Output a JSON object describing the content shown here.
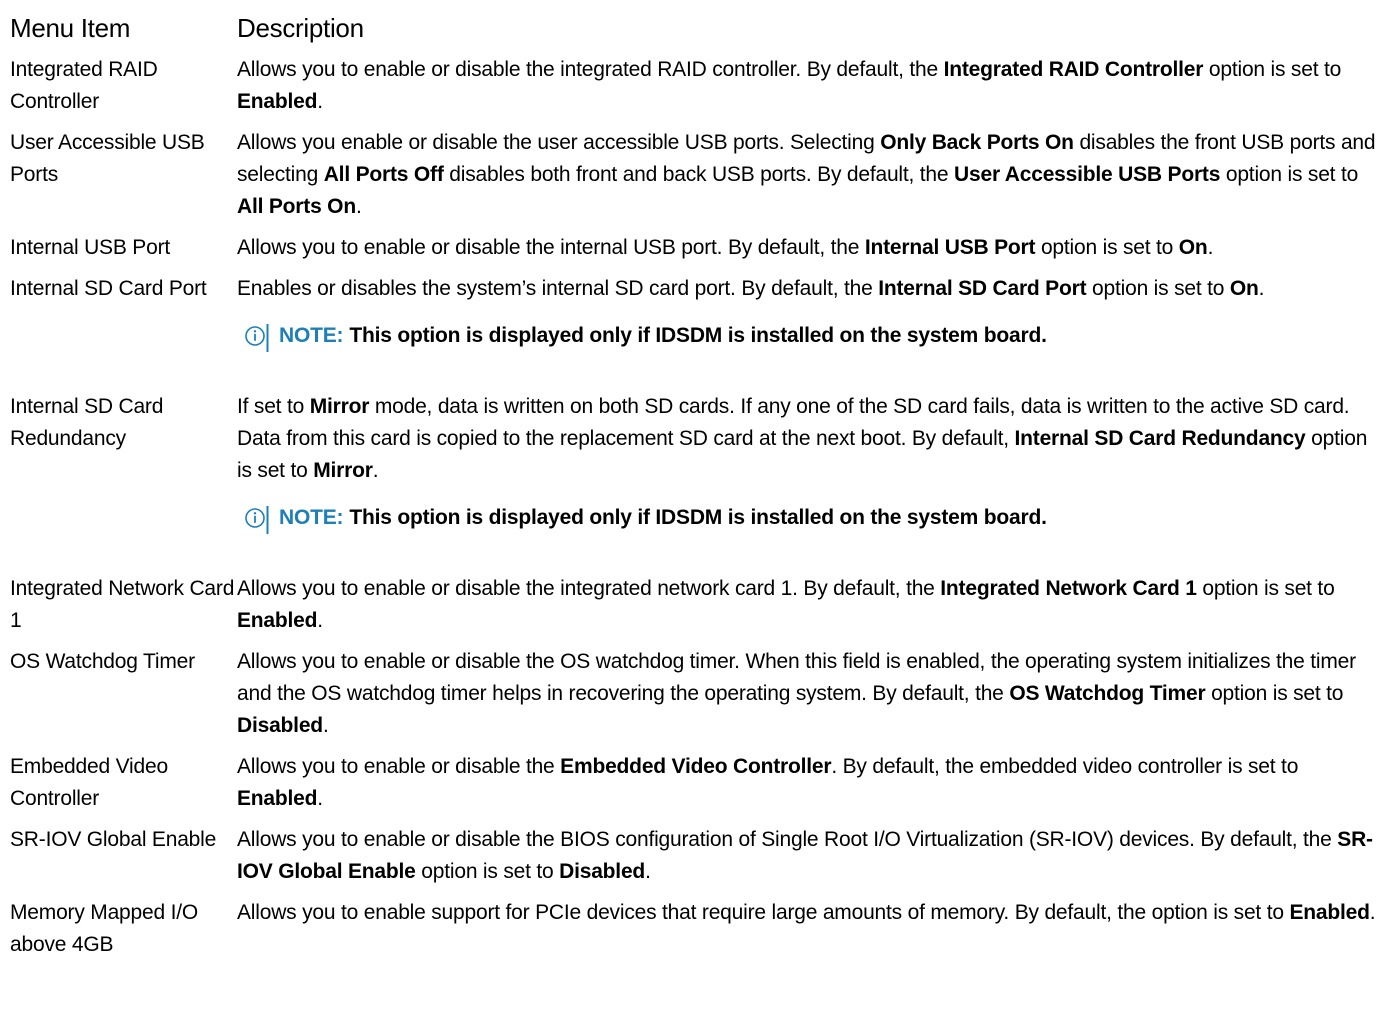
{
  "header": {
    "col1": "Menu Item",
    "col2": "Description"
  },
  "colors": {
    "note_accent": "#1E7FB8"
  },
  "note_icon": "info-icon",
  "rows": [
    {
      "item": "Integrated RAID Controller",
      "desc": [
        {
          "t": "Allows you to enable or disable the integrated RAID controller. By default, the "
        },
        {
          "t": "Integrated RAID Controller",
          "b": true
        },
        {
          "t": " option is set to "
        },
        {
          "t": "Enabled",
          "b": true
        },
        {
          "t": "."
        }
      ]
    },
    {
      "item": "User Accessible USB Ports",
      "desc": [
        {
          "t": "Allows you enable or disable the user accessible USB ports. Selecting "
        },
        {
          "t": "Only Back Ports On",
          "b": true
        },
        {
          "t": " disables the front USB ports and selecting "
        },
        {
          "t": "All Ports Off",
          "b": true
        },
        {
          "t": " disables both front and back USB ports. By default, the "
        },
        {
          "t": "User Accessible USB Ports",
          "b": true
        },
        {
          "t": " option is set to "
        },
        {
          "t": "All Ports On",
          "b": true
        },
        {
          "t": "."
        }
      ]
    },
    {
      "item": "Internal USB Port",
      "desc": [
        {
          "t": "Allows you to enable or disable the internal USB port. By default, the "
        },
        {
          "t": "Internal USB Port",
          "b": true
        },
        {
          "t": " option is set to "
        },
        {
          "t": "On",
          "b": true
        },
        {
          "t": "."
        }
      ]
    },
    {
      "item": "Internal SD Card Port",
      "desc": [
        {
          "t": "Enables or disables the system’s internal SD card port. By default, the "
        },
        {
          "t": "Internal SD Card Port",
          "b": true
        },
        {
          "t": " option is set to "
        },
        {
          "t": "On",
          "b": true
        },
        {
          "t": "."
        }
      ],
      "note": {
        "label": "NOTE:",
        "text": "This option is displayed only if IDSDM is installed on the system board."
      }
    },
    {
      "item": "Internal SD Card Redundancy",
      "desc": [
        {
          "t": "If set to "
        },
        {
          "t": "Mirror",
          "b": true
        },
        {
          "t": " mode, data is written on both SD cards. If any one of the SD card fails, data is written to the active SD card. Data from this card is copied to the replacement SD card at the next boot. By default, "
        },
        {
          "t": "Internal SD Card Redundancy",
          "b": true
        },
        {
          "t": " option is set to "
        },
        {
          "t": "Mirror",
          "b": true
        },
        {
          "t": "."
        }
      ],
      "note": {
        "label": "NOTE:",
        "text": "This option is displayed only if IDSDM is installed on the system board."
      }
    },
    {
      "item": "Integrated Network Card 1",
      "desc": [
        {
          "t": "Allows you to enable or disable the integrated network card 1. By default, the "
        },
        {
          "t": "Integrated Network Card 1",
          "b": true
        },
        {
          "t": " option is set to "
        },
        {
          "t": "Enabled",
          "b": true
        },
        {
          "t": "."
        }
      ]
    },
    {
      "item": "OS Watchdog Timer",
      "desc": [
        {
          "t": "Allows you to enable or disable the OS watchdog timer. When this field is enabled, the operating system initializes the timer and the OS watchdog timer helps in recovering the operating system. By default, the "
        },
        {
          "t": "OS Watchdog Timer",
          "b": true
        },
        {
          "t": " option is set to "
        },
        {
          "t": "Disabled",
          "b": true
        },
        {
          "t": "."
        }
      ]
    },
    {
      "item": "Embedded Video Controller",
      "desc": [
        {
          "t": "Allows you to enable or disable the "
        },
        {
          "t": "Embedded Video Controller",
          "b": true
        },
        {
          "t": ". By default, the embedded video controller is set to "
        },
        {
          "t": "Enabled",
          "b": true
        },
        {
          "t": "."
        }
      ]
    },
    {
      "item": "SR-IOV Global Enable",
      "desc": [
        {
          "t": "Allows you to enable or disable the BIOS configuration of Single Root I/O Virtualization (SR-IOV) devices. By default, the "
        },
        {
          "t": "SR-IOV Global Enable",
          "b": true
        },
        {
          "t": " option is set to "
        },
        {
          "t": "Disabled",
          "b": true
        },
        {
          "t": "."
        }
      ]
    },
    {
      "item": "Memory Mapped I/O above 4GB",
      "desc": [
        {
          "t": "Allows you to enable support for PCIe devices that require large amounts of memory. By default, the option is set to "
        },
        {
          "t": "Enabled",
          "b": true
        },
        {
          "t": "."
        }
      ]
    }
  ]
}
